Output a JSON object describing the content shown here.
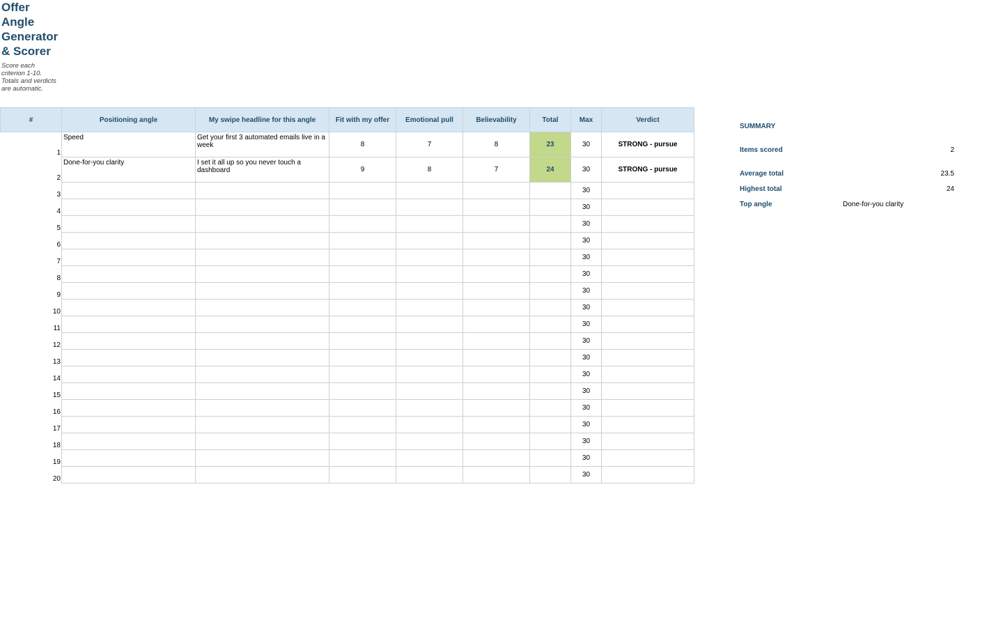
{
  "title": "Offer\nAngle\nGenerator\n& Scorer",
  "subtitle": "Score each\ncriterion 1-10.\nTotals and verdicts\nare automatic.",
  "table": {
    "headers": [
      "#",
      "Positioning angle",
      "My swipe headline for this angle",
      "Fit with my offer",
      "Emotional pull",
      "Believability",
      "Total",
      "Max",
      "Verdict"
    ],
    "rows": [
      {
        "num": "1",
        "angle": "Speed",
        "headline": "Get your first 3 automated emails live in a week",
        "fit": "8",
        "emotional": "7",
        "believability": "8",
        "total": "23",
        "max": "30",
        "verdict": "STRONG - pursue"
      },
      {
        "num": "2",
        "angle": "Done-for-you clarity",
        "headline": "I set it all up so you never touch a dashboard",
        "fit": "9",
        "emotional": "8",
        "believability": "7",
        "total": "24",
        "max": "30",
        "verdict": "STRONG - pursue"
      },
      {
        "num": "3",
        "angle": "",
        "headline": "",
        "fit": "",
        "emotional": "",
        "believability": "",
        "total": "",
        "max": "30",
        "verdict": ""
      },
      {
        "num": "4",
        "angle": "",
        "headline": "",
        "fit": "",
        "emotional": "",
        "believability": "",
        "total": "",
        "max": "30",
        "verdict": ""
      },
      {
        "num": "5",
        "angle": "",
        "headline": "",
        "fit": "",
        "emotional": "",
        "believability": "",
        "total": "",
        "max": "30",
        "verdict": ""
      },
      {
        "num": "6",
        "angle": "",
        "headline": "",
        "fit": "",
        "emotional": "",
        "believability": "",
        "total": "",
        "max": "30",
        "verdict": ""
      },
      {
        "num": "7",
        "angle": "",
        "headline": "",
        "fit": "",
        "emotional": "",
        "believability": "",
        "total": "",
        "max": "30",
        "verdict": ""
      },
      {
        "num": "8",
        "angle": "",
        "headline": "",
        "fit": "",
        "emotional": "",
        "believability": "",
        "total": "",
        "max": "30",
        "verdict": ""
      },
      {
        "num": "9",
        "angle": "",
        "headline": "",
        "fit": "",
        "emotional": "",
        "believability": "",
        "total": "",
        "max": "30",
        "verdict": ""
      },
      {
        "num": "10",
        "angle": "",
        "headline": "",
        "fit": "",
        "emotional": "",
        "believability": "",
        "total": "",
        "max": "30",
        "verdict": ""
      },
      {
        "num": "11",
        "angle": "",
        "headline": "",
        "fit": "",
        "emotional": "",
        "believability": "",
        "total": "",
        "max": "30",
        "verdict": ""
      },
      {
        "num": "12",
        "angle": "",
        "headline": "",
        "fit": "",
        "emotional": "",
        "believability": "",
        "total": "",
        "max": "30",
        "verdict": ""
      },
      {
        "num": "13",
        "angle": "",
        "headline": "",
        "fit": "",
        "emotional": "",
        "believability": "",
        "total": "",
        "max": "30",
        "verdict": ""
      },
      {
        "num": "14",
        "angle": "",
        "headline": "",
        "fit": "",
        "emotional": "",
        "believability": "",
        "total": "",
        "max": "30",
        "verdict": ""
      },
      {
        "num": "15",
        "angle": "",
        "headline": "",
        "fit": "",
        "emotional": "",
        "believability": "",
        "total": "",
        "max": "30",
        "verdict": ""
      },
      {
        "num": "16",
        "angle": "",
        "headline": "",
        "fit": "",
        "emotional": "",
        "believability": "",
        "total": "",
        "max": "30",
        "verdict": ""
      },
      {
        "num": "17",
        "angle": "",
        "headline": "",
        "fit": "",
        "emotional": "",
        "believability": "",
        "total": "",
        "max": "30",
        "verdict": ""
      },
      {
        "num": "18",
        "angle": "",
        "headline": "",
        "fit": "",
        "emotional": "",
        "believability": "",
        "total": "",
        "max": "30",
        "verdict": ""
      },
      {
        "num": "19",
        "angle": "",
        "headline": "",
        "fit": "",
        "emotional": "",
        "believability": "",
        "total": "",
        "max": "30",
        "verdict": ""
      },
      {
        "num": "20",
        "angle": "",
        "headline": "",
        "fit": "",
        "emotional": "",
        "believability": "",
        "total": "",
        "max": "30",
        "verdict": ""
      }
    ]
  },
  "summary": {
    "title": "SUMMARY",
    "items_scored_label": "Items scored",
    "items_scored_value": "2",
    "average_label": "Average total",
    "average_value": "23.5",
    "highest_label": "Highest total",
    "highest_value": "24",
    "top_angle_label": "Top angle",
    "top_angle_value": "Done-for-you clarity"
  },
  "colors": {
    "header_bg": "#d6e6f2",
    "header_text": "#1f4e6e",
    "total_highlight": "#c2d88a"
  }
}
